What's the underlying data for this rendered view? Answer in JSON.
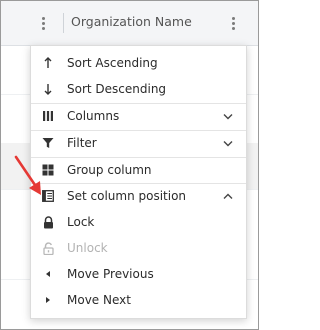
{
  "header": {
    "column_title": "Organization Name"
  },
  "menu": {
    "items": [
      {
        "label": "Sort Ascending",
        "icon": "arrow-up-icon"
      },
      {
        "label": "Sort Descending",
        "icon": "arrow-down-icon"
      },
      {
        "label": "Columns",
        "icon": "columns-icon",
        "expand": "chevron-down-icon"
      },
      {
        "label": "Filter",
        "icon": "filter-icon",
        "expand": "chevron-down-icon"
      },
      {
        "label": "Group column",
        "icon": "group-icon"
      },
      {
        "label": "Set column position",
        "icon": "column-position-icon",
        "expand": "chevron-up-icon"
      },
      {
        "label": "Lock",
        "icon": "lock-icon"
      },
      {
        "label": "Unlock",
        "icon": "unlock-icon",
        "disabled": true
      },
      {
        "label": "Move Previous",
        "icon": "caret-left-icon"
      },
      {
        "label": "Move Next",
        "icon": "caret-right-icon"
      }
    ]
  },
  "colors": {
    "annotation_arrow": "#e53935",
    "header_background": "#f4f5f7",
    "disabled_text": "#b3b3b3"
  }
}
